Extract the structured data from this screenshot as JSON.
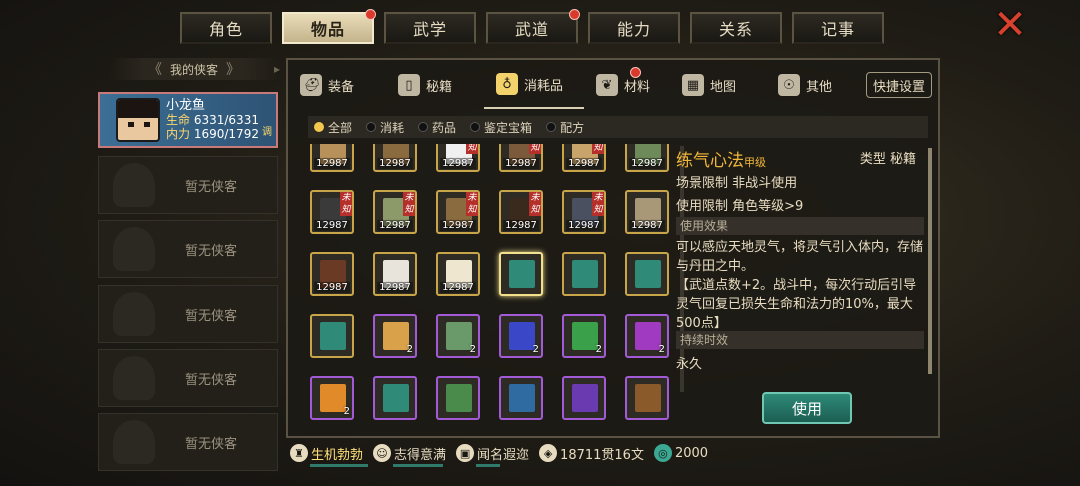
{
  "top_tabs": [
    {
      "label": "角色",
      "active": false,
      "dot": false
    },
    {
      "label": "物品",
      "active": true,
      "dot": true
    },
    {
      "label": "武学",
      "active": false,
      "dot": false
    },
    {
      "label": "武道",
      "active": false,
      "dot": true
    },
    {
      "label": "能力",
      "active": false,
      "dot": false
    },
    {
      "label": "关系",
      "active": false,
      "dot": false
    },
    {
      "label": "记事",
      "active": false,
      "dot": false
    }
  ],
  "close_glyph": "✕",
  "left": {
    "header": "我的侠客",
    "hero": {
      "name": "小龙鱼",
      "hp_label": "生命",
      "hp": "6331/6331",
      "mp_label": "内力",
      "mp": "1690/1792",
      "tune": "调"
    },
    "empty_slots": [
      "暂无侠客",
      "暂无侠客",
      "暂无侠客",
      "暂无侠客",
      "暂无侠客"
    ]
  },
  "category_tabs": [
    {
      "label": "装备",
      "icon": "helmet-icon",
      "active": false,
      "dot": false
    },
    {
      "label": "秘籍",
      "icon": "book-icon",
      "active": false,
      "dot": false
    },
    {
      "label": "消耗品",
      "icon": "potion-icon",
      "active": true,
      "dot": false
    },
    {
      "label": "材料",
      "icon": "herb-icon",
      "active": false,
      "dot": true
    },
    {
      "label": "地图",
      "icon": "map-icon",
      "active": false,
      "dot": false
    },
    {
      "label": "其他",
      "icon": "misc-icon",
      "active": false,
      "dot": false
    }
  ],
  "quick_settings": "快捷设置",
  "filters": [
    {
      "label": "全部",
      "on": true
    },
    {
      "label": "消耗",
      "on": false
    },
    {
      "label": "药品",
      "on": false
    },
    {
      "label": "鉴定宝箱",
      "on": false
    },
    {
      "label": "配方",
      "on": false
    }
  ],
  "unknown_tag": "未知",
  "items": [
    {
      "count": "12987",
      "unknown": false,
      "rare": false,
      "color": "#b8905a"
    },
    {
      "count": "12987",
      "unknown": false,
      "rare": false,
      "color": "#8a6a3f"
    },
    {
      "count": "12987",
      "unknown": true,
      "rare": false,
      "color": "#f0f0f0"
    },
    {
      "count": "12987",
      "unknown": true,
      "rare": false,
      "color": "#7a5a3a"
    },
    {
      "count": "12987",
      "unknown": true,
      "rare": false,
      "color": "#c9a46a"
    },
    {
      "count": "12987",
      "unknown": false,
      "rare": false,
      "color": "#6f8a5a"
    },
    {
      "count": "12987",
      "unknown": true,
      "rare": false,
      "color": "#3a3a3a"
    },
    {
      "count": "12987",
      "unknown": true,
      "rare": false,
      "color": "#8c9a6a"
    },
    {
      "count": "12987",
      "unknown": true,
      "rare": false,
      "color": "#8a6a3f"
    },
    {
      "count": "12987",
      "unknown": true,
      "rare": false,
      "color": "#3a2a1e"
    },
    {
      "count": "12987",
      "unknown": true,
      "rare": false,
      "color": "#4a5060"
    },
    {
      "count": "12987",
      "unknown": false,
      "rare": false,
      "color": "#a89878"
    },
    {
      "count": "12987",
      "unknown": false,
      "rare": false,
      "color": "#6a3a24"
    },
    {
      "count": "12987",
      "unknown": false,
      "rare": false,
      "color": "#e8e4dc"
    },
    {
      "count": "12987",
      "unknown": false,
      "rare": false,
      "color": "#efe6d0"
    },
    {
      "count": "",
      "unknown": false,
      "rare": false,
      "color": "#2f8a78",
      "selected": true
    },
    {
      "count": "",
      "unknown": false,
      "rare": false,
      "color": "#2f8a78"
    },
    {
      "count": "",
      "unknown": false,
      "rare": false,
      "color": "#2f8a78"
    },
    {
      "count": "",
      "unknown": false,
      "rare": false,
      "color": "#2f8a78"
    },
    {
      "count": "2",
      "unknown": false,
      "rare": true,
      "color": "#d9a24a"
    },
    {
      "count": "2",
      "unknown": false,
      "rare": true,
      "color": "#6a9a6a"
    },
    {
      "count": "2",
      "unknown": false,
      "rare": true,
      "color": "#3a48c8"
    },
    {
      "count": "2",
      "unknown": false,
      "rare": true,
      "color": "#3aa04a"
    },
    {
      "count": "2",
      "unknown": false,
      "rare": true,
      "color": "#a03ac0"
    },
    {
      "count": "2",
      "unknown": false,
      "rare": true,
      "color": "#e08a2a"
    },
    {
      "count": "",
      "unknown": false,
      "rare": true,
      "color": "#2f8a78"
    },
    {
      "count": "",
      "unknown": false,
      "rare": true,
      "color": "#4a8a4a"
    },
    {
      "count": "",
      "unknown": false,
      "rare": true,
      "color": "#2f6aa0"
    },
    {
      "count": "",
      "unknown": false,
      "rare": true,
      "color": "#6a3ab0"
    },
    {
      "count": "",
      "unknown": false,
      "rare": true,
      "color": "#8a5a2a"
    }
  ],
  "detail": {
    "name": "练气心法",
    "grade": "甲级",
    "type": "类型  秘籍",
    "scene": "场景限制   非战斗使用",
    "req": "使用限制   角色等级>9",
    "effect_header": "使用效果",
    "effect": "可以感应天地灵气，将灵气引入体内，存储与丹田之中。",
    "effect2": "【武道点数+2。战斗中，每次行动后引导灵气回复已损失生命和法力的10%，最大500点】",
    "duration_header": "持续时效",
    "duration": "永久",
    "use_button": "使用"
  },
  "status": [
    {
      "label": "生机勃勃",
      "icon": "body-icon",
      "accent": true
    },
    {
      "label": "志得意满",
      "icon": "face-icon",
      "accent": false
    },
    {
      "label": "闻名遐迩",
      "icon": "fame-icon",
      "accent": false
    },
    {
      "label": "18711贯16文",
      "icon": "coin-icon",
      "accent": false
    },
    {
      "label": "2000",
      "icon": "jade-icon",
      "accent": false
    }
  ]
}
